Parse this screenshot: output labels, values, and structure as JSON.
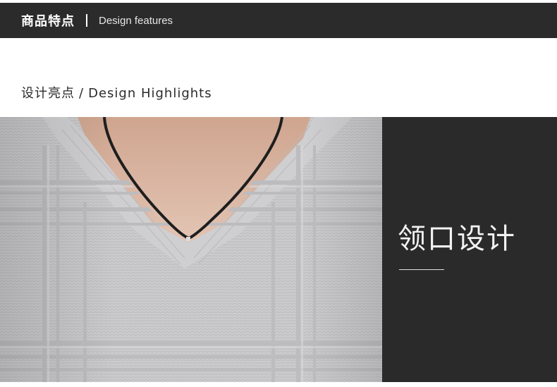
{
  "header": {
    "title_cn": "商品特点",
    "title_en": "Design features"
  },
  "section": {
    "subtitle_cn": "设计亮点",
    "slash": "/",
    "subtitle_en": "Design Highlights"
  },
  "feature": {
    "title": "领口设计"
  },
  "colors": {
    "header_bg": "#2b2b2b",
    "panel_bg": "#2a2a2a",
    "sweater": "#c9c9cb",
    "skin": "#d8b6a4"
  }
}
